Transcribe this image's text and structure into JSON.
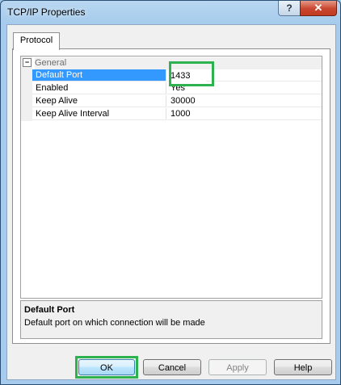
{
  "window": {
    "title": "TCP/IP Properties",
    "help_glyph": "?",
    "close_glyph": "✕"
  },
  "tabs": [
    {
      "label": "Protocol"
    }
  ],
  "grid": {
    "category": {
      "label": "General",
      "expander": "⊟"
    },
    "properties": [
      {
        "name": "Default Port",
        "value": "1433",
        "selected": true
      },
      {
        "name": "Enabled",
        "value": "Yes"
      },
      {
        "name": "Keep Alive",
        "value": "30000"
      },
      {
        "name": "Keep Alive Interval",
        "value": "1000"
      }
    ]
  },
  "description": {
    "title": "Default Port",
    "text": "Default port on which connection will be made"
  },
  "buttons": {
    "ok": "OK",
    "cancel": "Cancel",
    "apply": "Apply",
    "help": "Help"
  },
  "colors": {
    "highlight": "#2eb24f",
    "selection": "#3399ff",
    "title_bar": "#a6cbec",
    "close_button": "#c9462e"
  }
}
